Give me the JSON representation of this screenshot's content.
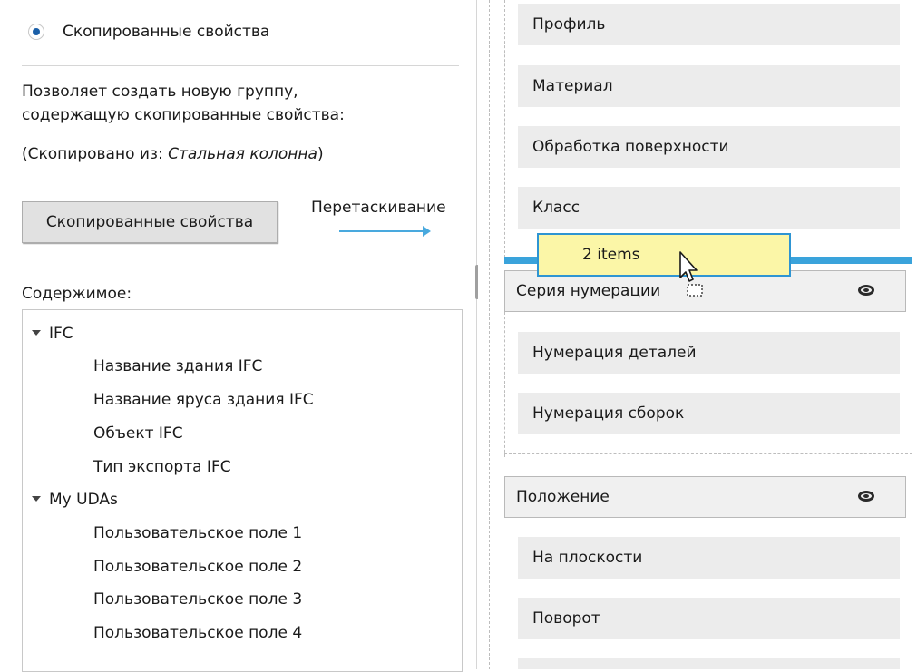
{
  "left": {
    "radio_label": "Скопированные свойства",
    "description_line1": "Позволяет создать новую группу,",
    "description_line2": "содержащую скопированные свойства:",
    "copied_from_prefix": "(Скопировано из: ",
    "copied_from_object": "Стальная колонна",
    "copied_from_suffix": ")",
    "copy_button": "Скопированные свойства",
    "drag_label": "Перетаскивание",
    "contents_title": "Содержимое:",
    "tree": [
      {
        "label": "IFC",
        "type": "group"
      },
      {
        "label": "Название здания IFC",
        "type": "item"
      },
      {
        "label": "Название яруса здания IFC",
        "type": "item"
      },
      {
        "label": "Объект IFC",
        "type": "item"
      },
      {
        "label": "Тип экспорта IFC",
        "type": "item"
      },
      {
        "label": "My UDAs",
        "type": "group"
      },
      {
        "label": "Пользовательское поле 1",
        "type": "item"
      },
      {
        "label": "Пользовательское поле 2",
        "type": "item"
      },
      {
        "label": "Пользовательское поле 3",
        "type": "item"
      },
      {
        "label": "Пользовательское поле 4",
        "type": "item"
      }
    ]
  },
  "right": {
    "props_top": [
      "Профиль",
      "Материал",
      "Обработка поверхности",
      "Класс"
    ],
    "drag_tooltip": "2 items",
    "group_numbering": "Серия нумерации",
    "props_numbering": [
      "Нумерация деталей",
      "Нумерация сборок"
    ],
    "group_position": "Положение",
    "props_position": [
      "На плоскости",
      "Поворот"
    ]
  },
  "icons": {
    "eye": "eye-icon",
    "caret": "caret-down-icon",
    "radio": "radio-selected-icon",
    "cursor": "drag-cursor-icon"
  },
  "colors": {
    "accent": "#3aa3db",
    "tooltip_bg": "#fbf6a7",
    "radio_dot": "#1a5fa8"
  }
}
